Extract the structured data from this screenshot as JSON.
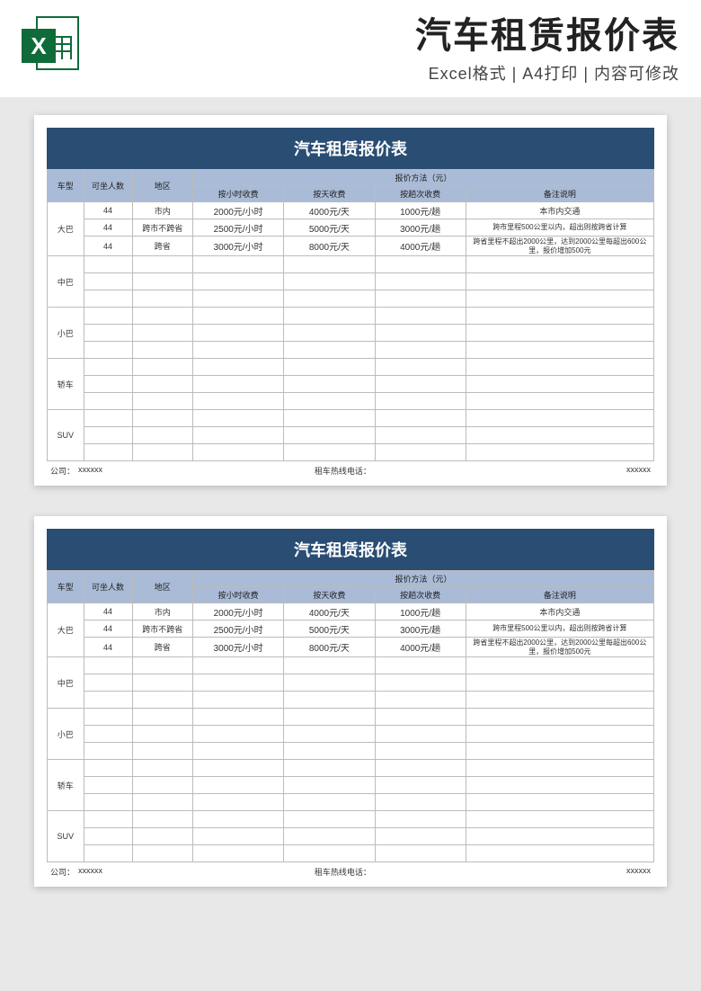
{
  "header": {
    "main_title": "汽车租赁报价表",
    "subtitle": "Excel格式 | A4打印 | 内容可修改",
    "icon_letter": "X"
  },
  "sheet": {
    "title": "汽车租赁报价表",
    "columns": {
      "type": "车型",
      "seats": "可坐人数",
      "area": "地区",
      "method_group": "报价方法（元）",
      "by_hour": "按小时收费",
      "by_day": "按天收费",
      "by_trip": "按趟次收费",
      "remark": "备注说明"
    },
    "vehicle_types": [
      "大巴",
      "中巴",
      "小巴",
      "轿车",
      "SUV"
    ],
    "rows": [
      {
        "seats": "44",
        "area": "市内",
        "hour": "2000元/小时",
        "day": "4000元/天",
        "trip": "1000元/趟",
        "remark": "本市内交通"
      },
      {
        "seats": "44",
        "area": "跨市不跨省",
        "hour": "2500元/小时",
        "day": "5000元/天",
        "trip": "3000元/趟",
        "remark": "跨市里程500公里以内，超出则按跨省计算"
      },
      {
        "seats": "44",
        "area": "跨省",
        "hour": "3000元/小时",
        "day": "8000元/天",
        "trip": "4000元/趟",
        "remark": "跨省里程不超出2000公里，达到2000公里每超出600公里，报价增加500元"
      }
    ],
    "footer": {
      "company_label": "公司：",
      "company_value": "xxxxxx",
      "hotline_label": "租车热线电话：",
      "hotline_value": "xxxxxx"
    }
  }
}
